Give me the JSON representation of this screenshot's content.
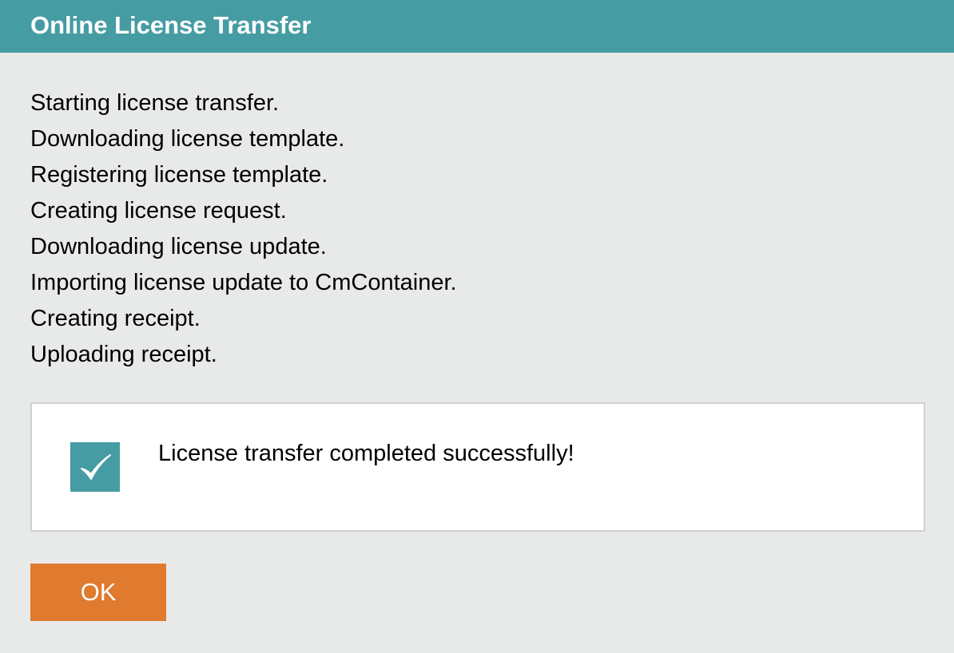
{
  "dialog": {
    "title": "Online License Transfer"
  },
  "log": {
    "lines": [
      "Starting license transfer.",
      "Downloading license template.",
      "Registering license template.",
      "Creating license request.",
      "Downloading license update.",
      "Importing license update to CmContainer.",
      "Creating receipt.",
      "Uploading receipt."
    ]
  },
  "result": {
    "icon": "checkmark-icon",
    "message": "License transfer completed successfully!"
  },
  "buttons": {
    "ok_label": "OK"
  },
  "colors": {
    "title_bar": "#469ca3",
    "background": "#e8eae9",
    "check_box": "#469ca3",
    "ok_button": "#e07a2f"
  }
}
